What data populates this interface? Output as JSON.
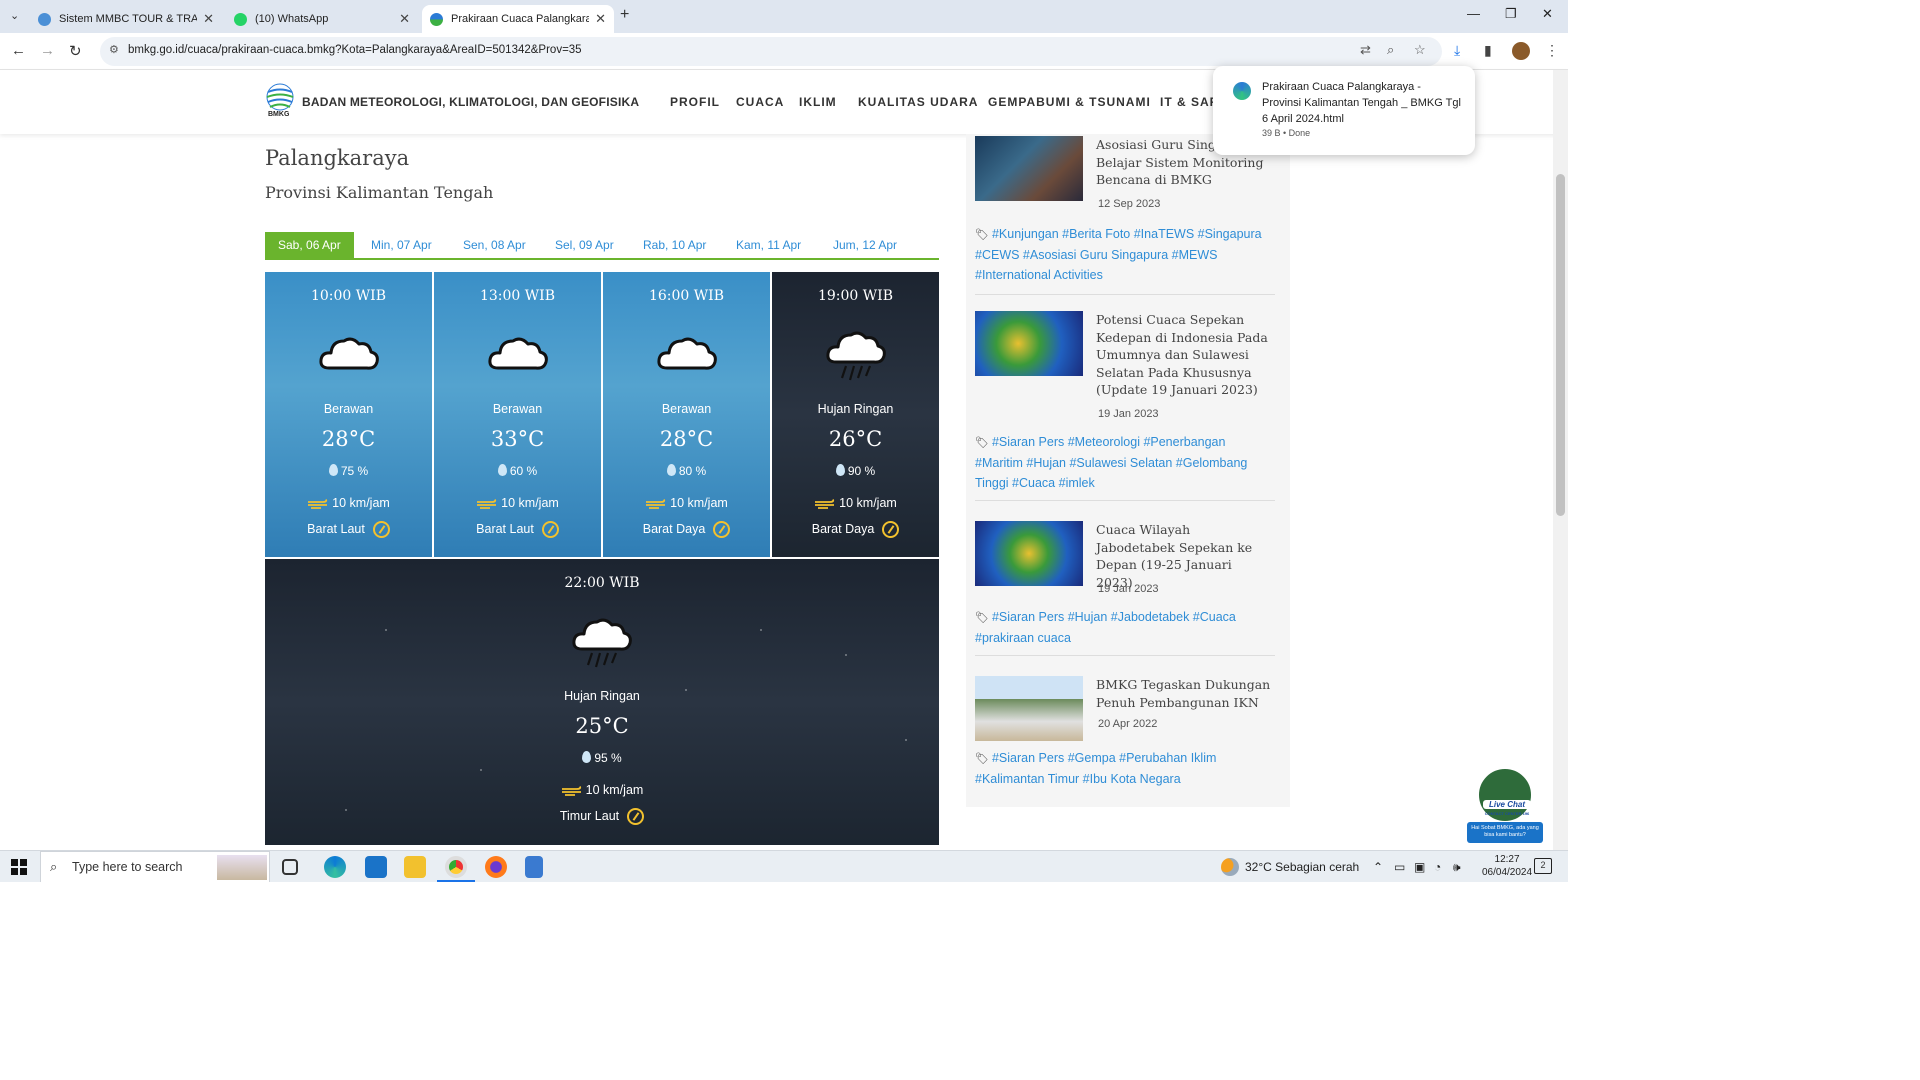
{
  "browser": {
    "tabs": [
      {
        "label": "Sistem MMBC TOUR & TRAVEL",
        "favicon": "globe-icon",
        "active": false
      },
      {
        "label": "(10) WhatsApp",
        "favicon": "whatsapp-icon",
        "active": false
      },
      {
        "label": "Prakiraan Cuaca Palangkaraya -",
        "favicon": "bmkg-icon",
        "active": true
      }
    ],
    "new_tab": "+",
    "url": "bmkg.go.id/cuaca/prakiraan-cuaca.bmkg?Kota=Palangkaraya&AreaID=501342&Prov=35"
  },
  "download": {
    "filename": "Prakiraan Cuaca Palangkaraya - Provinsi Kalimantan Tengah _ BMKG Tgl 6 April 2024.html",
    "status": "39 B • Done"
  },
  "site": {
    "logo_text": "BMKG",
    "brand": "BADAN METEOROLOGI, KLIMATOLOGI, DAN GEOFISIKA",
    "menu": [
      "PROFIL",
      "CUACA",
      "IKLIM",
      "KUALITAS UDARA",
      "GEMPABUMI & TSUNAMI",
      "IT & SAR"
    ]
  },
  "main": {
    "city": "Palangkaraya",
    "province": "Provinsi Kalimantan Tengah",
    "day_tabs": [
      "Sab, 06 Apr",
      "Min, 07 Apr",
      "Sen, 08 Apr",
      "Sel, 09 Apr",
      "Rab, 10 Apr",
      "Kam, 11 Apr",
      "Jum, 12 Apr"
    ],
    "active_day": "Sab, 06 Apr",
    "forecasts": [
      {
        "time": "10:00 WIB",
        "condition": "Berawan",
        "temp": "28°C",
        "humidity": "75 %",
        "wind": "10 km/jam",
        "direction": "Barat Laut",
        "icon": "cloud-icon",
        "theme": "day"
      },
      {
        "time": "13:00 WIB",
        "condition": "Berawan",
        "temp": "33°C",
        "humidity": "60 %",
        "wind": "10 km/jam",
        "direction": "Barat Laut",
        "icon": "cloud-icon",
        "theme": "day"
      },
      {
        "time": "16:00 WIB",
        "condition": "Berawan",
        "temp": "28°C",
        "humidity": "80 %",
        "wind": "10 km/jam",
        "direction": "Barat Daya",
        "icon": "cloud-icon",
        "theme": "day"
      },
      {
        "time": "19:00 WIB",
        "condition": "Hujan Ringan",
        "temp": "26°C",
        "humidity": "90 %",
        "wind": "10 km/jam",
        "direction": "Barat Daya",
        "icon": "rain-cloud-icon",
        "theme": "night"
      },
      {
        "time": "22:00 WIB",
        "condition": "Hujan Ringan",
        "temp": "25°C",
        "humidity": "95 %",
        "wind": "10 km/jam",
        "direction": "Timur Laut",
        "icon": "rain-cloud-icon",
        "theme": "night"
      }
    ]
  },
  "sidebar": {
    "news": [
      {
        "title": "Asosiasi Guru Singapura Belajar Sistem Monitoring Bencana di BMKG",
        "date": "12 Sep 2023",
        "tags": "#Kunjungan #Berita Foto #InaTEWS #Singapura #CEWS #Asosiasi Guru Singapura #MEWS #International Activities"
      },
      {
        "title": "Potensi Cuaca Sepekan Kedepan di Indonesia Pada Umumnya dan Sulawesi Selatan Pada Khususnya (Update 19 Januari 2023)",
        "date": "19 Jan 2023",
        "tags": "#Siaran Pers #Meteorologi #Penerbangan #Maritim #Hujan #Sulawesi Selatan #Gelombang Tinggi #Cuaca #imlek"
      },
      {
        "title": "Cuaca Wilayah Jabodetabek Sepekan ke Depan (19-25 Januari 2023)",
        "date": "19 Jan 2023",
        "tags": "#Siaran Pers #Hujan #Jabodetabek #Cuaca #prakiraan cuaca"
      },
      {
        "title": "BMKG Tegaskan Dukungan Penuh Pembangunan IKN",
        "date": "20 Apr 2022",
        "tags": "#Siaran Pers #Gempa #Perubahan Iklim #Kalimantan Timur #Ibu Kota Negara"
      }
    ]
  },
  "livechat": {
    "title": "Live Chat",
    "sub": "CONTACT CENTER 196",
    "msg": "Hai Sobat BMKG, ada yang bisa kami bantu?"
  },
  "taskbar": {
    "search_placeholder": "Type here to search",
    "weather": "32°C  Sebagian cerah",
    "time": "12:27",
    "date": "06/04/2024",
    "notifications": "2"
  }
}
